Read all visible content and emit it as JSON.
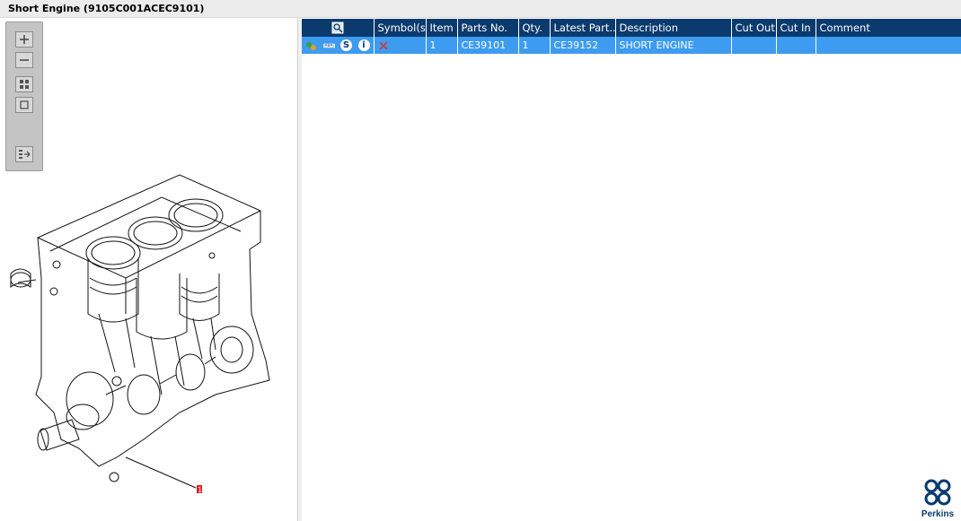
{
  "window": {
    "title": "Short Engine (9105C001ACEC9101)"
  },
  "toolbar": {
    "zoom_in": "zoom-in-icon",
    "zoom_out": "zoom-out-icon",
    "fit_all": "fit-all-icon",
    "fit_page": "fit-page-icon",
    "export": "export-icon"
  },
  "drawing": {
    "callout_label": "1"
  },
  "table": {
    "columns": [
      "",
      "Symbol(s)",
      "Item",
      "Parts No.",
      "Qty.",
      "Latest Part...",
      "Description",
      "Cut Out",
      "Cut In",
      "Comment"
    ],
    "rows": [
      {
        "symbol": "superseded-x-icon",
        "item": "1",
        "part_no": "CE39101",
        "qty": "1",
        "latest_part": "CE39152",
        "description": "SHORT ENGINE",
        "cut_out": "",
        "cut_in": "",
        "comment": "",
        "circle_s": "S",
        "circle_i": "i"
      }
    ]
  },
  "branding": {
    "logo_text": "Perkins"
  },
  "colors": {
    "header_bg": "#0a3a6e",
    "row_selected": "#3d9bf0",
    "callout_red": "#e02020"
  }
}
